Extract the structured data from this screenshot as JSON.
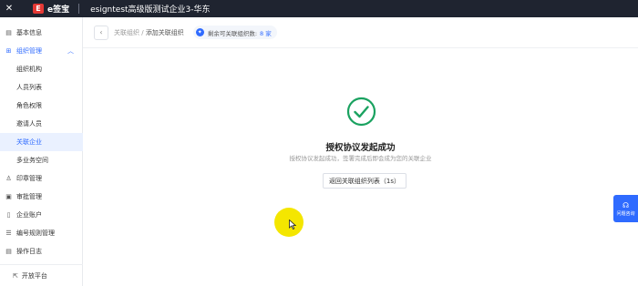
{
  "topbar": {
    "close_glyph": "✕",
    "logo_mark": "E",
    "logo_text": "e签宝",
    "company": "esigntest高级版测试企业3-华东"
  },
  "sidebar": {
    "items": [
      {
        "label": "基本信息",
        "icon": "info-icon"
      },
      {
        "label": "组织管理",
        "icon": "org-icon"
      },
      {
        "label": "组织机构"
      },
      {
        "label": "人员列表"
      },
      {
        "label": "角色权限"
      },
      {
        "label": "邀请人员"
      },
      {
        "label": "关联企业"
      },
      {
        "label": "多业务空间"
      },
      {
        "label": "印章管理",
        "icon": "seal-icon"
      },
      {
        "label": "审批管理",
        "icon": "approval-icon"
      },
      {
        "label": "企业账户",
        "icon": "account-icon"
      },
      {
        "label": "编号规则管理",
        "icon": "numbering-icon"
      },
      {
        "label": "操作日志",
        "icon": "log-icon"
      }
    ],
    "footer": {
      "label": "开放平台",
      "icon": "open-platform-icon"
    }
  },
  "header": {
    "breadcrumb_parent": "关联组织",
    "breadcrumb_sep": " / ",
    "breadcrumb_current": "添加关联组织",
    "quota_label": "剩余可关联组织数:",
    "quota_value": "8 家"
  },
  "result": {
    "title": "授权协议发起成功",
    "description": "授权协议发起成功，签署完成后即会成为您的关联企业",
    "return_button": "返回关联组织列表（1s）"
  },
  "help": {
    "label": "问题咨询"
  },
  "colors": {
    "accent": "#2f6bff",
    "success": "#1aa260",
    "topbar": "#1f2430",
    "cursor_highlight": "#f4e600"
  }
}
